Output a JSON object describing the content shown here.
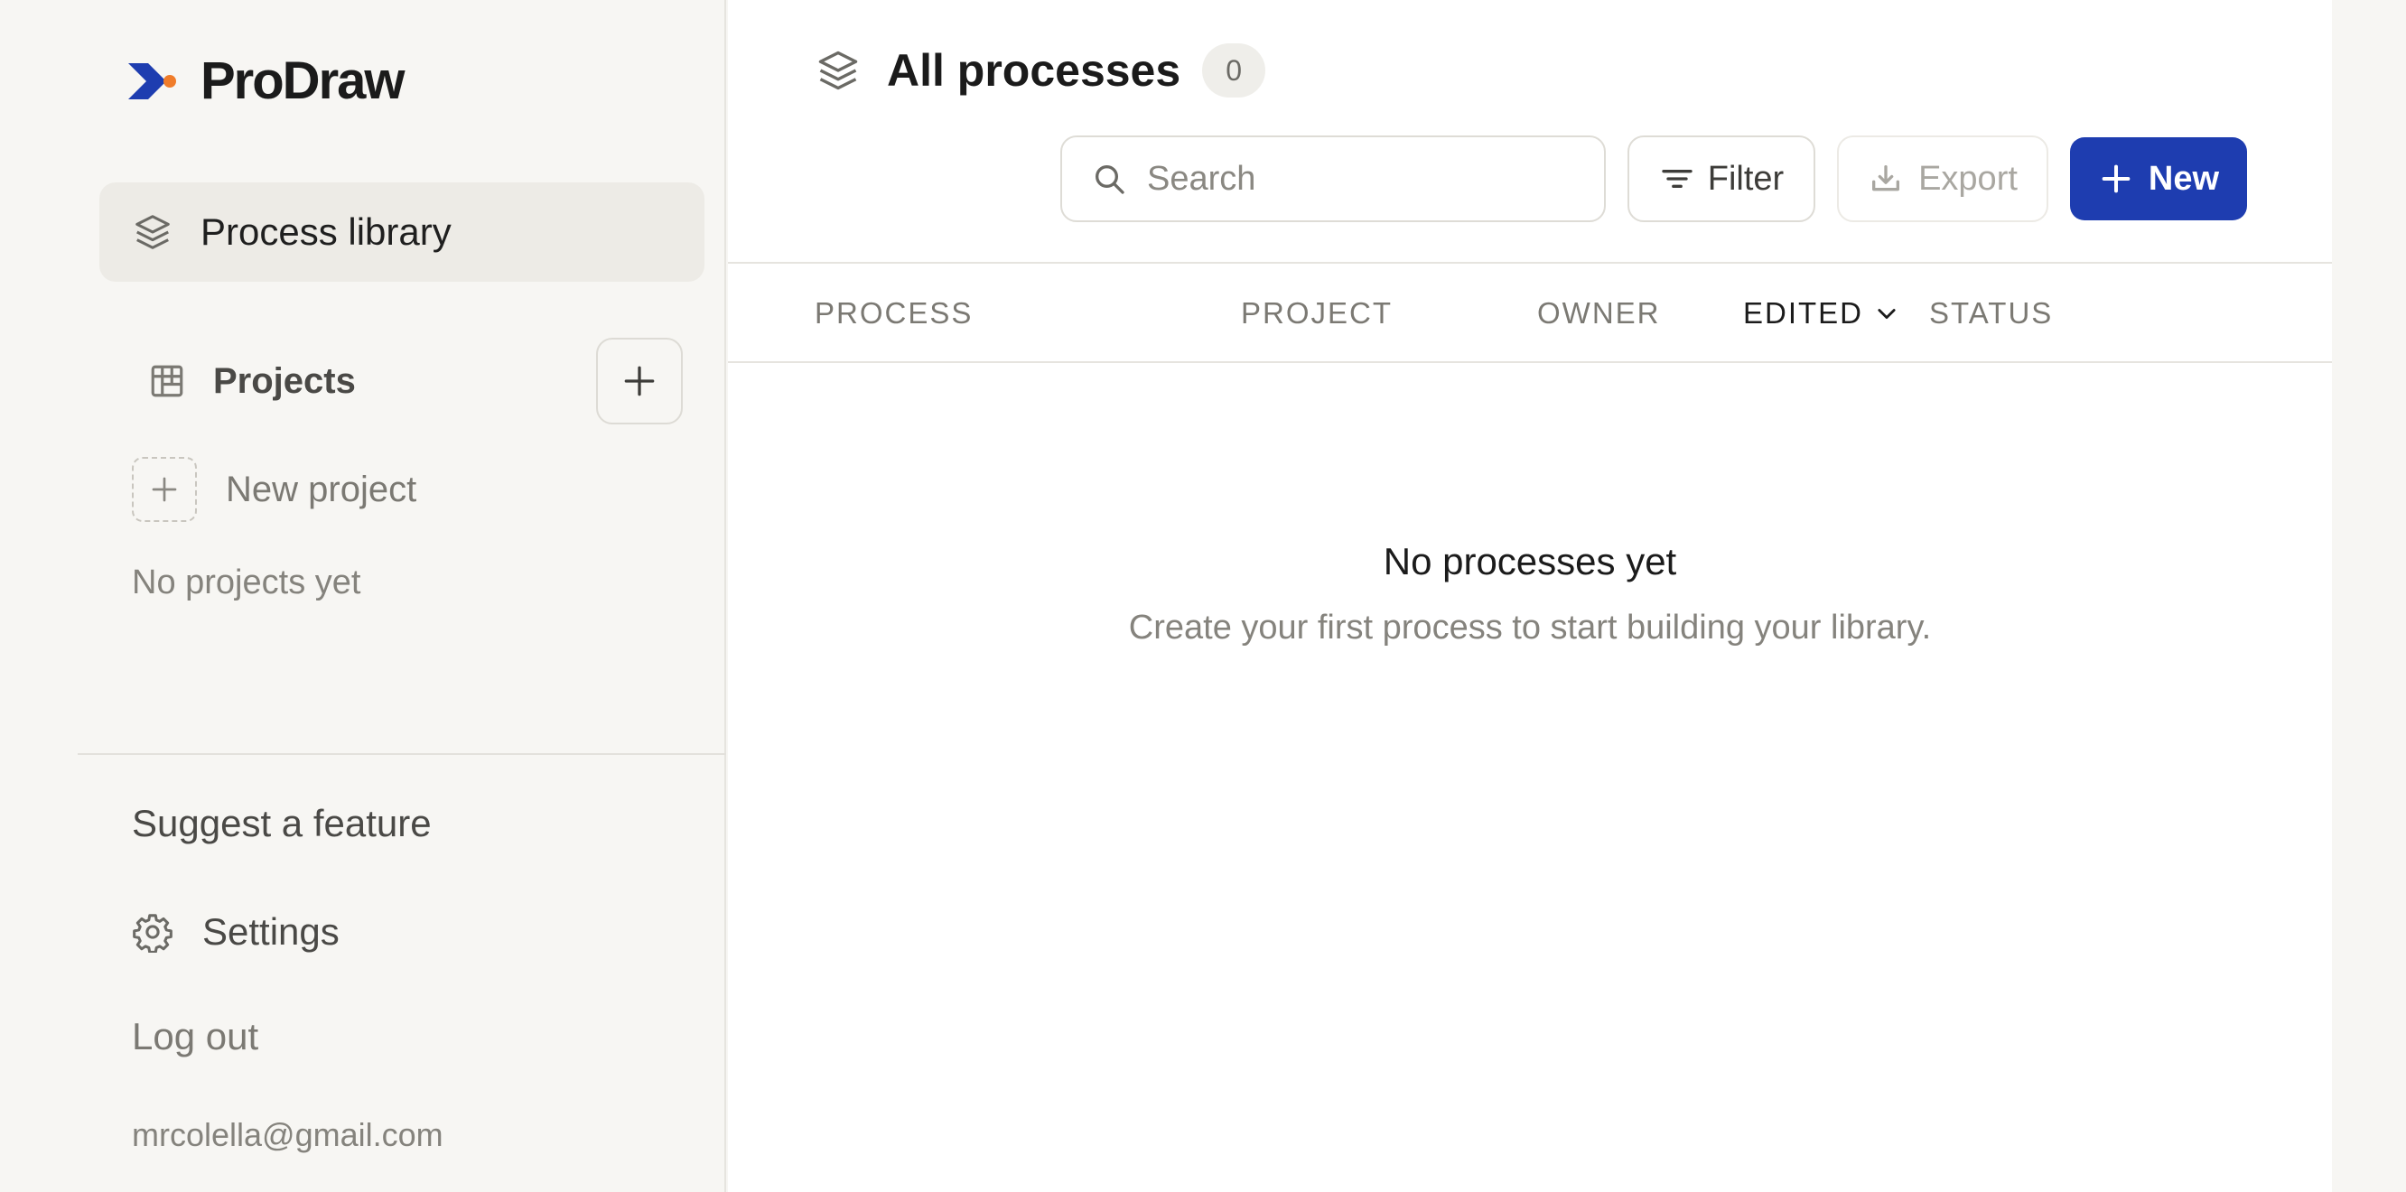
{
  "app": {
    "name": "ProDraw",
    "colors": {
      "accent": "#1e3db0",
      "logo_dot": "#f07c2a"
    }
  },
  "sidebar": {
    "primary_nav": {
      "label": "Process library",
      "icon": "layers-icon",
      "active": true
    },
    "projects": {
      "label": "Projects",
      "icon": "board-icon",
      "add_icon": "plus-icon",
      "new_project_label": "New project",
      "empty_text": "No projects yet"
    },
    "footer": {
      "suggest_label": "Suggest a feature",
      "settings_label": "Settings",
      "settings_icon": "gear-icon",
      "logout_label": "Log out",
      "user_email": "mrcolella@gmail.com"
    }
  },
  "main": {
    "title": "All processes",
    "title_icon": "layers-icon",
    "count": "0",
    "toolbar": {
      "search_placeholder": "Search",
      "search_value": "",
      "filter_label": "Filter",
      "export_label": "Export",
      "new_label": "New"
    },
    "table": {
      "columns": [
        {
          "label": "PROCESS"
        },
        {
          "label": "PROJECT"
        },
        {
          "label": "OWNER"
        },
        {
          "label": "EDITED",
          "sorted": true
        },
        {
          "label": "STATUS"
        }
      ]
    },
    "empty_state": {
      "title": "No processes yet",
      "subtitle": "Create your first process to start building your library."
    }
  }
}
